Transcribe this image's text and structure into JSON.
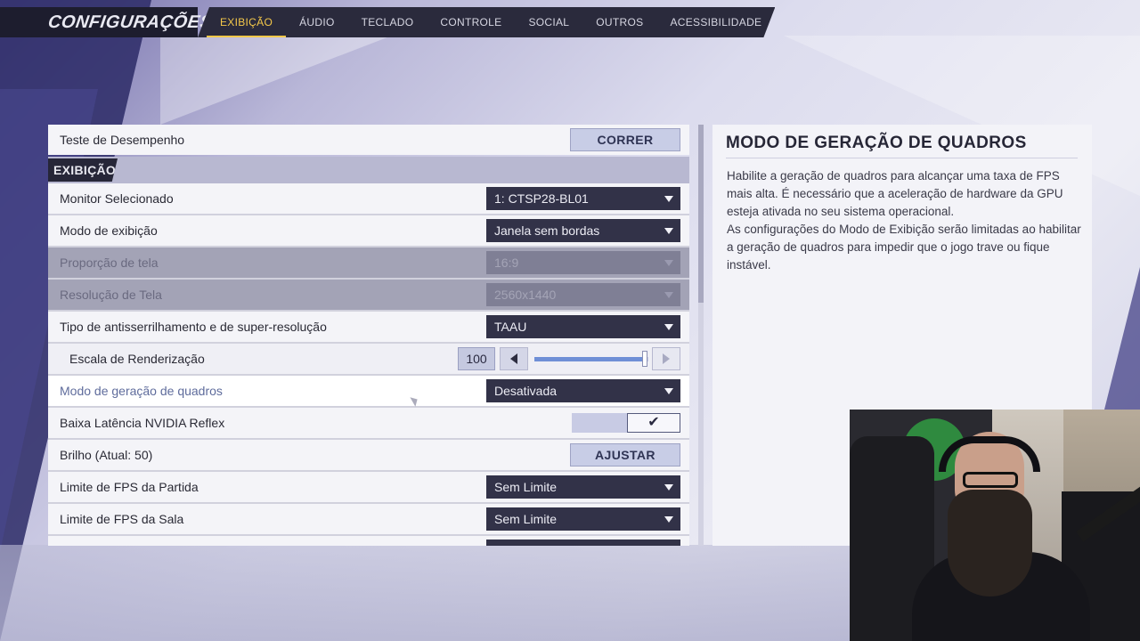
{
  "header": {
    "title": "CONFIGURAÇÕES",
    "tabs": [
      {
        "label": "EXIBIÇÃO",
        "active": true
      },
      {
        "label": "ÁUDIO"
      },
      {
        "label": "TECLADO"
      },
      {
        "label": "CONTROLE"
      },
      {
        "label": "SOCIAL"
      },
      {
        "label": "OUTROS"
      },
      {
        "label": "ACESSIBILIDADE"
      }
    ]
  },
  "settings": {
    "benchmark": {
      "label": "Teste de Desempenho",
      "button": "CORRER"
    },
    "section_title": "EXIBIÇÃO",
    "monitor": {
      "label": "Monitor Selecionado",
      "value": "1: CTSP28-BL01"
    },
    "display_mode": {
      "label": "Modo de exibição",
      "value": "Janela sem bordas"
    },
    "aspect_ratio": {
      "label": "Proporção de tela",
      "value": "16:9",
      "disabled": true
    },
    "resolution": {
      "label": "Resolução de Tela",
      "value": "2560x1440",
      "disabled": true
    },
    "antialiasing": {
      "label": "Tipo de antisserrilhamento e de super-resolução",
      "value": "TAAU"
    },
    "render_scale": {
      "label": "Escala de Renderização",
      "value": "100",
      "fraction": 0.97
    },
    "frame_gen": {
      "label": "Modo de geração de quadros",
      "value": "Desativada"
    },
    "reflex": {
      "label": "Baixa Latência NVIDIA Reflex",
      "checked": true
    },
    "brightness": {
      "label": "Brilho (Atual: 50)",
      "button": "AJUSTAR"
    },
    "fps_match": {
      "label": "Limite de FPS da Partida",
      "value": "Sem Limite"
    },
    "fps_lobby": {
      "label": "Limite de FPS da Sala",
      "value": "Sem Limite"
    }
  },
  "info": {
    "title": "MODO DE GERAÇÃO DE QUADROS",
    "paragraph1": "Habilite a geração de quadros para alcançar uma taxa de FPS mais alta. É necessário que a aceleração de hardware da GPU esteja ativada no seu sistema operacional.",
    "paragraph2": "As configurações do Modo de Exibição serão limitadas ao habilitar a geração de quadros para impedir que o jogo trave ou fique instável."
  },
  "icons": {
    "dropdown": "chevron-down-icon",
    "check": "check-icon",
    "left": "arrow-left-icon",
    "right": "arrow-right-icon"
  },
  "colors": {
    "accent": "#f4c84a",
    "dropdown_bg": "#323248",
    "header_bg": "#1d1d2e"
  }
}
